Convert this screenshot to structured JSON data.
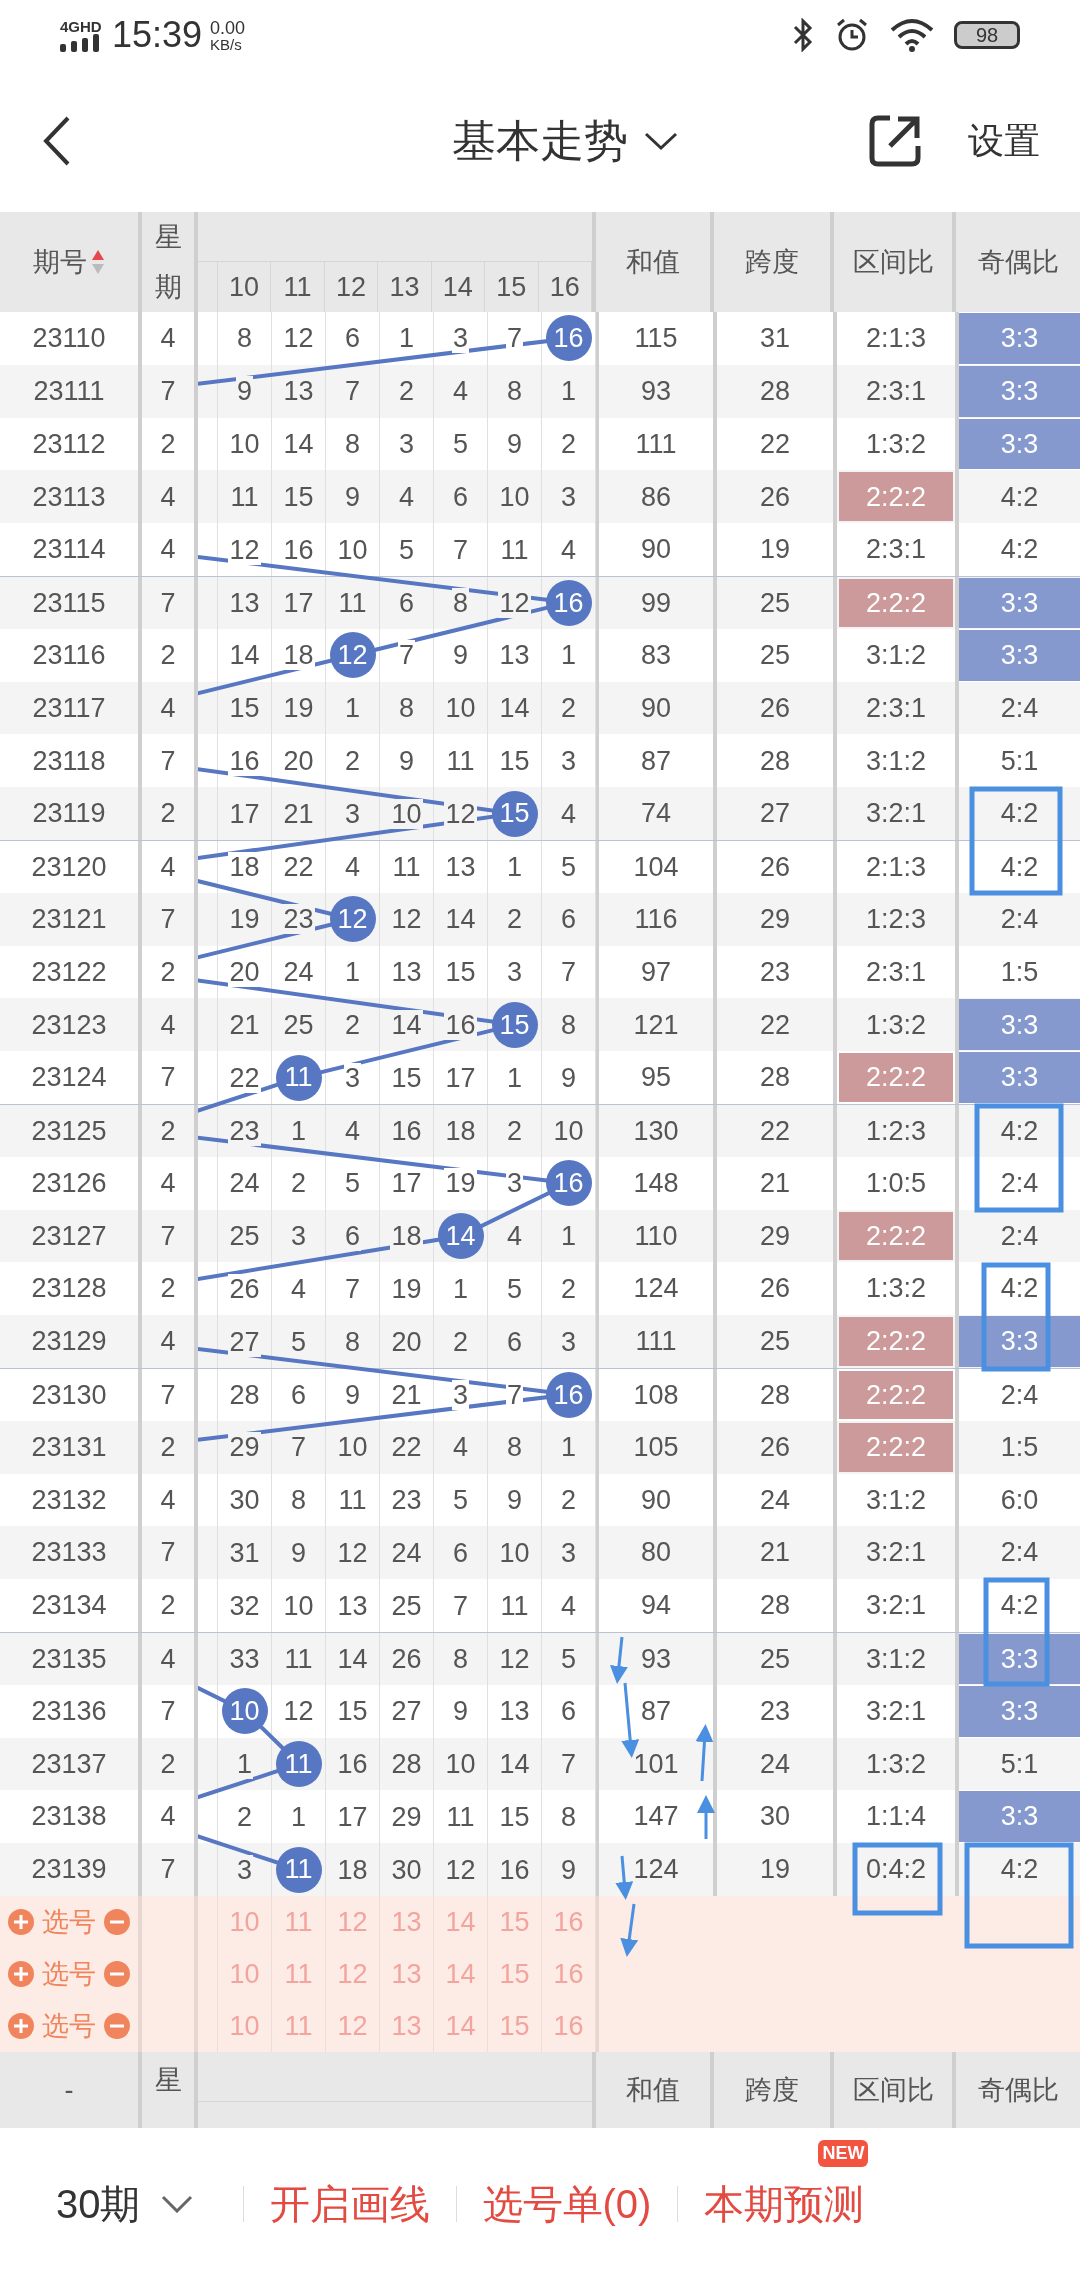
{
  "status_bar": {
    "network": "4GHD",
    "time": "15:39",
    "speed_value": "0.00",
    "speed_unit": "KB/s",
    "battery": "98"
  },
  "header": {
    "title": "基本走势",
    "settings": "设置"
  },
  "table_header": {
    "period": "期号",
    "weekday_top": "星",
    "weekday_bottom": "期",
    "numbers": [
      "10",
      "11",
      "12",
      "13",
      "14",
      "15",
      "16"
    ],
    "sum": "和值",
    "span": "跨度",
    "zone_ratio": "区间比",
    "parity": "奇偶比"
  },
  "rows": [
    {
      "period": "23110",
      "weekday": "4",
      "numbers": [
        "8",
        "12",
        "6",
        "1",
        "3",
        "7",
        "16"
      ],
      "drawn": [
        false,
        false,
        false,
        false,
        false,
        false,
        true
      ],
      "sum": "115",
      "span": "31",
      "zone_ratio": "2:1:3",
      "zone_highlighted": false,
      "parity": "3:3",
      "parity_highlighted": true
    },
    {
      "period": "23111",
      "weekday": "7",
      "numbers": [
        "9",
        "13",
        "7",
        "2",
        "4",
        "8",
        "1"
      ],
      "drawn": [
        false,
        false,
        false,
        false,
        false,
        false,
        false
      ],
      "sum": "93",
      "span": "28",
      "zone_ratio": "2:3:1",
      "zone_highlighted": false,
      "parity": "3:3",
      "parity_highlighted": true
    },
    {
      "period": "23112",
      "weekday": "2",
      "numbers": [
        "10",
        "14",
        "8",
        "3",
        "5",
        "9",
        "2"
      ],
      "drawn": [
        false,
        false,
        false,
        false,
        false,
        false,
        false
      ],
      "sum": "111",
      "span": "22",
      "zone_ratio": "1:3:2",
      "zone_highlighted": false,
      "parity": "3:3",
      "parity_highlighted": true
    },
    {
      "period": "23113",
      "weekday": "4",
      "numbers": [
        "11",
        "15",
        "9",
        "4",
        "6",
        "10",
        "3"
      ],
      "drawn": [
        false,
        false,
        false,
        false,
        false,
        false,
        false
      ],
      "sum": "86",
      "span": "26",
      "zone_ratio": "2:2:2",
      "zone_highlighted": true,
      "parity": "4:2",
      "parity_highlighted": false
    },
    {
      "period": "23114",
      "weekday": "4",
      "numbers": [
        "12",
        "16",
        "10",
        "5",
        "7",
        "11",
        "4"
      ],
      "drawn": [
        false,
        false,
        false,
        false,
        false,
        false,
        false
      ],
      "sum": "90",
      "span": "19",
      "zone_ratio": "2:3:1",
      "zone_highlighted": false,
      "parity": "4:2",
      "parity_highlighted": false
    },
    {
      "period": "23115",
      "weekday": "7",
      "numbers": [
        "13",
        "17",
        "11",
        "6",
        "8",
        "12",
        "16"
      ],
      "drawn": [
        false,
        false,
        false,
        false,
        false,
        false,
        true
      ],
      "sum": "99",
      "span": "25",
      "zone_ratio": "2:2:2",
      "zone_highlighted": true,
      "parity": "3:3",
      "parity_highlighted": true
    },
    {
      "period": "23116",
      "weekday": "2",
      "numbers": [
        "14",
        "18",
        "12",
        "7",
        "9",
        "13",
        "1"
      ],
      "drawn": [
        false,
        false,
        true,
        false,
        false,
        false,
        false
      ],
      "sum": "83",
      "span": "25",
      "zone_ratio": "3:1:2",
      "zone_highlighted": false,
      "parity": "3:3",
      "parity_highlighted": true
    },
    {
      "period": "23117",
      "weekday": "4",
      "numbers": [
        "15",
        "19",
        "1",
        "8",
        "10",
        "14",
        "2"
      ],
      "drawn": [
        false,
        false,
        false,
        false,
        false,
        false,
        false
      ],
      "sum": "90",
      "span": "26",
      "zone_ratio": "2:3:1",
      "zone_highlighted": false,
      "parity": "2:4",
      "parity_highlighted": false
    },
    {
      "period": "23118",
      "weekday": "7",
      "numbers": [
        "16",
        "20",
        "2",
        "9",
        "11",
        "15",
        "3"
      ],
      "drawn": [
        false,
        false,
        false,
        false,
        false,
        false,
        false
      ],
      "sum": "87",
      "span": "28",
      "zone_ratio": "3:1:2",
      "zone_highlighted": false,
      "parity": "5:1",
      "parity_highlighted": false
    },
    {
      "period": "23119",
      "weekday": "2",
      "numbers": [
        "17",
        "21",
        "3",
        "10",
        "12",
        "15",
        "4"
      ],
      "drawn": [
        false,
        false,
        false,
        false,
        false,
        true,
        false
      ],
      "sum": "74",
      "span": "27",
      "zone_ratio": "3:2:1",
      "zone_highlighted": false,
      "parity": "4:2",
      "parity_highlighted": false
    },
    {
      "period": "23120",
      "weekday": "4",
      "numbers": [
        "18",
        "22",
        "4",
        "11",
        "13",
        "1",
        "5"
      ],
      "drawn": [
        false,
        false,
        false,
        false,
        false,
        false,
        false
      ],
      "sum": "104",
      "span": "26",
      "zone_ratio": "2:1:3",
      "zone_highlighted": false,
      "parity": "4:2",
      "parity_highlighted": false
    },
    {
      "period": "23121",
      "weekday": "7",
      "numbers": [
        "19",
        "23",
        "12",
        "12",
        "14",
        "2",
        "6"
      ],
      "drawn": [
        false,
        false,
        true,
        false,
        false,
        false,
        false
      ],
      "sum": "116",
      "span": "29",
      "zone_ratio": "1:2:3",
      "zone_highlighted": false,
      "parity": "2:4",
      "parity_highlighted": false
    },
    {
      "period": "23122",
      "weekday": "2",
      "numbers": [
        "20",
        "24",
        "1",
        "13",
        "15",
        "3",
        "7"
      ],
      "drawn": [
        false,
        false,
        false,
        false,
        false,
        false,
        false
      ],
      "sum": "97",
      "span": "23",
      "zone_ratio": "2:3:1",
      "zone_highlighted": false,
      "parity": "1:5",
      "parity_highlighted": false
    },
    {
      "period": "23123",
      "weekday": "4",
      "numbers": [
        "21",
        "25",
        "2",
        "14",
        "16",
        "15",
        "8"
      ],
      "drawn": [
        false,
        false,
        false,
        false,
        false,
        true,
        false
      ],
      "sum": "121",
      "span": "22",
      "zone_ratio": "1:3:2",
      "zone_highlighted": false,
      "parity": "3:3",
      "parity_highlighted": true
    },
    {
      "period": "23124",
      "weekday": "7",
      "numbers": [
        "22",
        "11",
        "3",
        "15",
        "17",
        "1",
        "9"
      ],
      "drawn": [
        false,
        true,
        false,
        false,
        false,
        false,
        false
      ],
      "sum": "95",
      "span": "28",
      "zone_ratio": "2:2:2",
      "zone_highlighted": true,
      "parity": "3:3",
      "parity_highlighted": true
    },
    {
      "period": "23125",
      "weekday": "2",
      "numbers": [
        "23",
        "1",
        "4",
        "16",
        "18",
        "2",
        "10"
      ],
      "drawn": [
        false,
        false,
        false,
        false,
        false,
        false,
        false
      ],
      "sum": "130",
      "span": "22",
      "zone_ratio": "1:2:3",
      "zone_highlighted": false,
      "parity": "4:2",
      "parity_highlighted": false
    },
    {
      "period": "23126",
      "weekday": "4",
      "numbers": [
        "24",
        "2",
        "5",
        "17",
        "19",
        "3",
        "16"
      ],
      "drawn": [
        false,
        false,
        false,
        false,
        false,
        false,
        true
      ],
      "sum": "148",
      "span": "21",
      "zone_ratio": "1:0:5",
      "zone_highlighted": false,
      "parity": "2:4",
      "parity_highlighted": false
    },
    {
      "period": "23127",
      "weekday": "7",
      "numbers": [
        "25",
        "3",
        "6",
        "18",
        "14",
        "4",
        "1"
      ],
      "drawn": [
        false,
        false,
        false,
        false,
        true,
        false,
        false
      ],
      "sum": "110",
      "span": "29",
      "zone_ratio": "2:2:2",
      "zone_highlighted": true,
      "parity": "2:4",
      "parity_highlighted": false
    },
    {
      "period": "23128",
      "weekday": "2",
      "numbers": [
        "26",
        "4",
        "7",
        "19",
        "1",
        "5",
        "2"
      ],
      "drawn": [
        false,
        false,
        false,
        false,
        false,
        false,
        false
      ],
      "sum": "124",
      "span": "26",
      "zone_ratio": "1:3:2",
      "zone_highlighted": false,
      "parity": "4:2",
      "parity_highlighted": false
    },
    {
      "period": "23129",
      "weekday": "4",
      "numbers": [
        "27",
        "5",
        "8",
        "20",
        "2",
        "6",
        "3"
      ],
      "drawn": [
        false,
        false,
        false,
        false,
        false,
        false,
        false
      ],
      "sum": "111",
      "span": "25",
      "zone_ratio": "2:2:2",
      "zone_highlighted": true,
      "parity": "3:3",
      "parity_highlighted": true
    },
    {
      "period": "23130",
      "weekday": "7",
      "numbers": [
        "28",
        "6",
        "9",
        "21",
        "3",
        "7",
        "16"
      ],
      "drawn": [
        false,
        false,
        false,
        false,
        false,
        false,
        true
      ],
      "sum": "108",
      "span": "28",
      "zone_ratio": "2:2:2",
      "zone_highlighted": true,
      "parity": "2:4",
      "parity_highlighted": false
    },
    {
      "period": "23131",
      "weekday": "2",
      "numbers": [
        "29",
        "7",
        "10",
        "22",
        "4",
        "8",
        "1"
      ],
      "drawn": [
        false,
        false,
        false,
        false,
        false,
        false,
        false
      ],
      "sum": "105",
      "span": "26",
      "zone_ratio": "2:2:2",
      "zone_highlighted": true,
      "parity": "1:5",
      "parity_highlighted": false
    },
    {
      "period": "23132",
      "weekday": "4",
      "numbers": [
        "30",
        "8",
        "11",
        "23",
        "5",
        "9",
        "2"
      ],
      "drawn": [
        false,
        false,
        false,
        false,
        false,
        false,
        false
      ],
      "sum": "90",
      "span": "24",
      "zone_ratio": "3:1:2",
      "zone_highlighted": false,
      "parity": "6:0",
      "parity_highlighted": false
    },
    {
      "period": "23133",
      "weekday": "7",
      "numbers": [
        "31",
        "9",
        "12",
        "24",
        "6",
        "10",
        "3"
      ],
      "drawn": [
        false,
        false,
        false,
        false,
        false,
        false,
        false
      ],
      "sum": "80",
      "span": "21",
      "zone_ratio": "3:2:1",
      "zone_highlighted": false,
      "parity": "2:4",
      "parity_highlighted": false
    },
    {
      "period": "23134",
      "weekday": "2",
      "numbers": [
        "32",
        "10",
        "13",
        "25",
        "7",
        "11",
        "4"
      ],
      "drawn": [
        false,
        false,
        false,
        false,
        false,
        false,
        false
      ],
      "sum": "94",
      "span": "28",
      "zone_ratio": "3:2:1",
      "zone_highlighted": false,
      "parity": "4:2",
      "parity_highlighted": false
    },
    {
      "period": "23135",
      "weekday": "4",
      "numbers": [
        "33",
        "11",
        "14",
        "26",
        "8",
        "12",
        "5"
      ],
      "drawn": [
        false,
        false,
        false,
        false,
        false,
        false,
        false
      ],
      "sum": "93",
      "span": "25",
      "zone_ratio": "3:1:2",
      "zone_highlighted": false,
      "parity": "3:3",
      "parity_highlighted": true
    },
    {
      "period": "23136",
      "weekday": "7",
      "numbers": [
        "10",
        "12",
        "15",
        "27",
        "9",
        "13",
        "6"
      ],
      "drawn": [
        true,
        false,
        false,
        false,
        false,
        false,
        false
      ],
      "sum": "87",
      "span": "23",
      "zone_ratio": "3:2:1",
      "zone_highlighted": false,
      "parity": "3:3",
      "parity_highlighted": true
    },
    {
      "period": "23137",
      "weekday": "2",
      "numbers": [
        "1",
        "11",
        "16",
        "28",
        "10",
        "14",
        "7"
      ],
      "drawn": [
        false,
        true,
        false,
        false,
        false,
        false,
        false
      ],
      "sum": "101",
      "span": "24",
      "zone_ratio": "1:3:2",
      "zone_highlighted": false,
      "parity": "5:1",
      "parity_highlighted": false
    },
    {
      "period": "23138",
      "weekday": "4",
      "numbers": [
        "2",
        "1",
        "17",
        "29",
        "11",
        "15",
        "8"
      ],
      "drawn": [
        false,
        false,
        false,
        false,
        false,
        false,
        false
      ],
      "sum": "147",
      "span": "30",
      "zone_ratio": "1:1:4",
      "zone_highlighted": false,
      "parity": "3:3",
      "parity_highlighted": true
    },
    {
      "period": "23139",
      "weekday": "7",
      "numbers": [
        "3",
        "11",
        "18",
        "30",
        "12",
        "16",
        "9"
      ],
      "drawn": [
        false,
        true,
        false,
        false,
        false,
        false,
        false
      ],
      "sum": "124",
      "span": "19",
      "zone_ratio": "0:4:2",
      "zone_highlighted": false,
      "parity": "4:2",
      "parity_highlighted": false
    }
  ],
  "picker_rows": [
    {
      "label": "选号",
      "numbers": [
        "10",
        "11",
        "12",
        "13",
        "14",
        "15",
        "16"
      ]
    },
    {
      "label": "选号",
      "numbers": [
        "10",
        "11",
        "12",
        "13",
        "14",
        "15",
        "16"
      ]
    },
    {
      "label": "选号",
      "numbers": [
        "10",
        "11",
        "12",
        "13",
        "14",
        "15",
        "16"
      ]
    }
  ],
  "footer_header": {
    "period": "-",
    "weekday_top": "星",
    "sum": "和值",
    "span": "跨度",
    "zone_ratio": "区间比",
    "parity": "奇偶比"
  },
  "bottom_bar": {
    "period_select": "30期",
    "actions": [
      {
        "label": "开启画线"
      },
      {
        "label": "选号单(0)"
      },
      {
        "label": "本期预测",
        "badge": "NEW"
      }
    ]
  }
}
